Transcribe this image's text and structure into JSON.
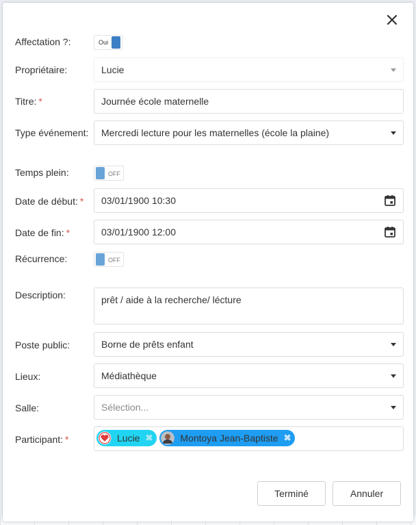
{
  "form": {
    "affectation": {
      "label": "Affectation ?:",
      "toggle_text": "Oui"
    },
    "proprietaire": {
      "label": "Propriétaire:",
      "value": "Lucie"
    },
    "titre": {
      "label": "Titre:",
      "required": "*",
      "value": "Journée école maternelle"
    },
    "type_evenement": {
      "label": "Type événement:",
      "value": "Mercredi lecture pour les maternelles (école la plaine)"
    },
    "temps_plein": {
      "label": "Temps plein:",
      "toggle_text": "OFF"
    },
    "date_debut": {
      "label": "Date de début:",
      "required": "*",
      "value": "03/01/1900 10:30"
    },
    "date_fin": {
      "label": "Date de fin:",
      "required": "*",
      "value": "03/01/1900 12:00"
    },
    "recurrence": {
      "label": "Récurrence:",
      "toggle_text": "OFF"
    },
    "description": {
      "label": "Description:",
      "value": "prêt / aide à la recherche/ lécture"
    },
    "poste_public": {
      "label": "Poste public:",
      "value": "Borne de prêts enfant"
    },
    "lieux": {
      "label": "Lieux:",
      "value": "Médiathèque"
    },
    "salle": {
      "label": "Salle:",
      "placeholder": "Sélection..."
    },
    "participant": {
      "label": "Participant:",
      "required": "*",
      "tags": [
        {
          "name": "Lucie",
          "remove": "✖"
        },
        {
          "name": "Montoya Jean-Baptiste",
          "remove": "✖"
        }
      ]
    }
  },
  "buttons": {
    "done": "Terminé",
    "cancel": "Annuler"
  },
  "icons": {
    "close": "close-icon",
    "calendar": "calendar-icon",
    "dropdown": "chevron-down-icon",
    "heart_avatar": "heart-avatar-icon",
    "person_avatar": "avatar"
  },
  "colors": {
    "accent": "#3b7fc4",
    "required": "#d9534f",
    "tag_lucie": "#21d4f2",
    "tag_montoya": "#1e9df2"
  }
}
